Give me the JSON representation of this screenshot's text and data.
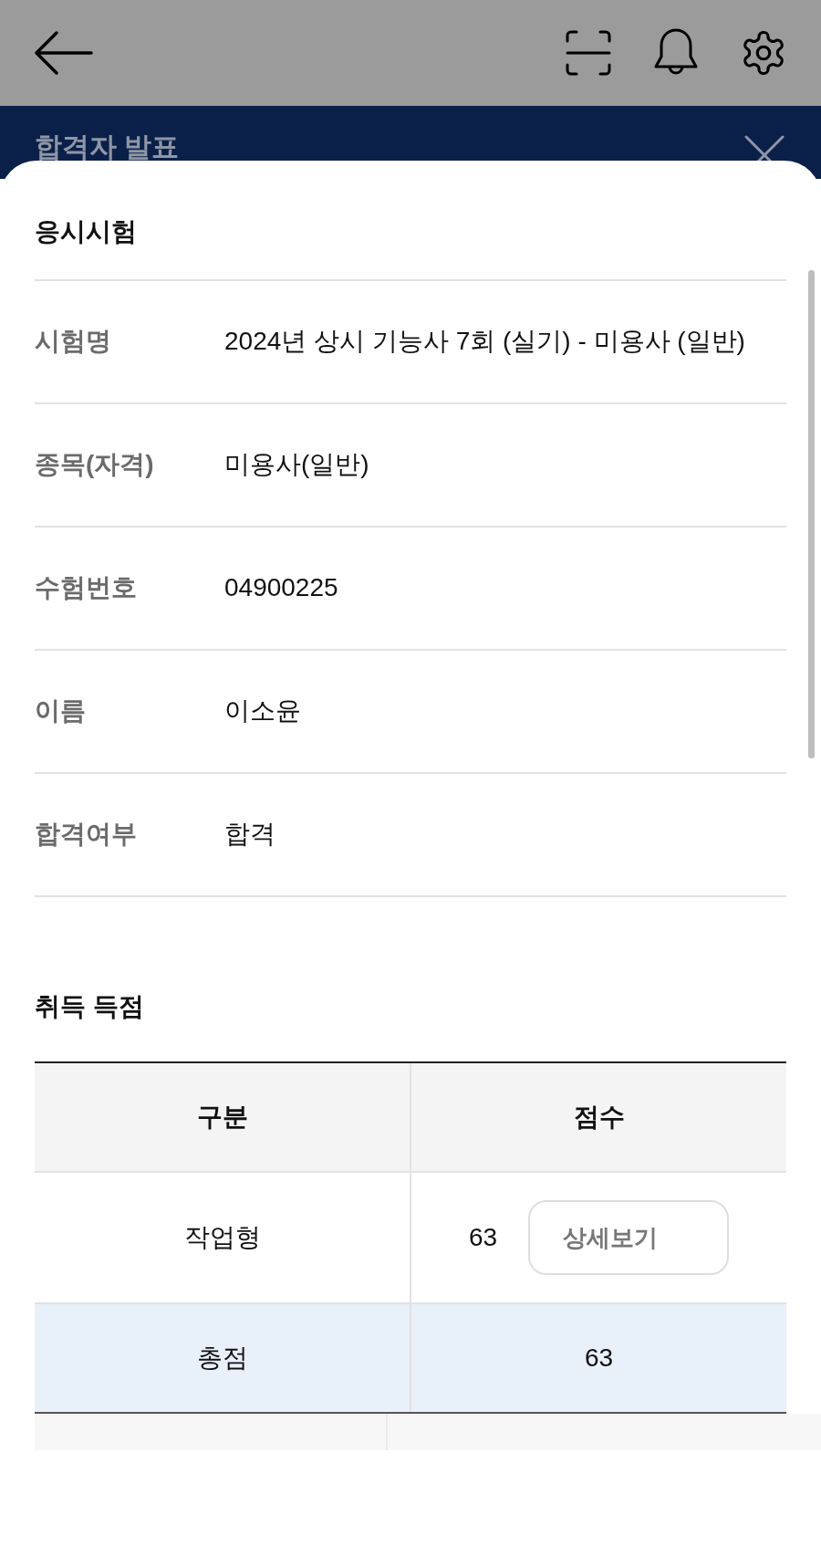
{
  "header": {
    "title": "합격자 발표"
  },
  "exam": {
    "title": "응시시험",
    "rows": [
      {
        "label": "시험명",
        "value": "2024년 상시 기능사 7회 (실기) - 미용사 (일반)"
      },
      {
        "label": "종목(자격)",
        "value": "미용사(일반)"
      },
      {
        "label": "수험번호",
        "value": "04900225"
      },
      {
        "label": "이름",
        "value": "이소윤"
      },
      {
        "label": "합격여부",
        "value": "합격"
      }
    ]
  },
  "score": {
    "title": "취득 득점",
    "columns": [
      "구분",
      "점수"
    ],
    "rows": [
      {
        "kind": "item",
        "category": "작업형",
        "score": "63",
        "button": "상세보기"
      },
      {
        "kind": "total",
        "category": "총점",
        "score": "63"
      }
    ]
  }
}
